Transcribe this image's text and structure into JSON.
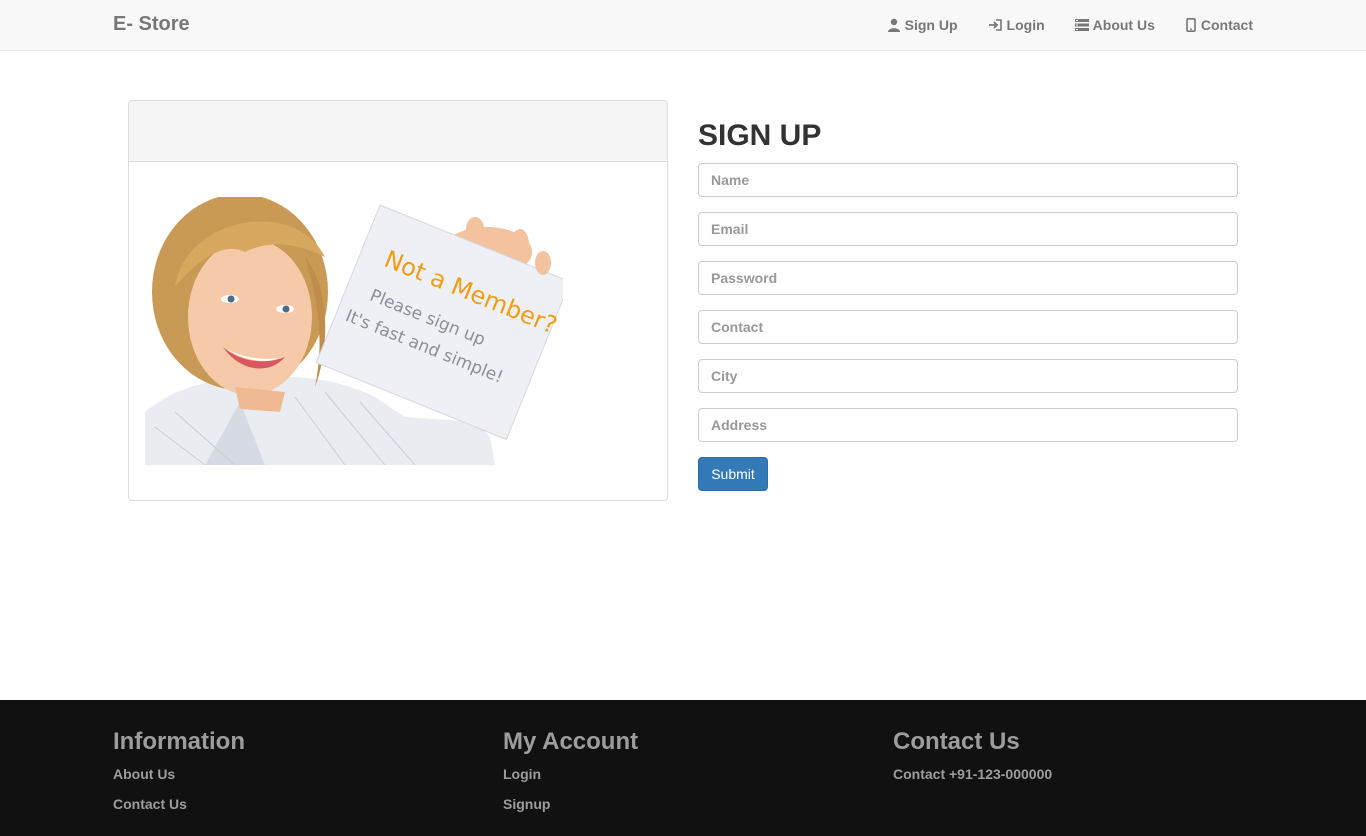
{
  "navbar": {
    "brand": "E- Store",
    "items": [
      {
        "label": "Sign Up",
        "icon": "user-icon"
      },
      {
        "label": "Login",
        "icon": "login-icon"
      },
      {
        "label": "About Us",
        "icon": "list-icon"
      },
      {
        "label": "Contact",
        "icon": "phone-icon"
      }
    ]
  },
  "promo": {
    "headline": "Not a Member?",
    "line1": "Please sign up",
    "line2": "It's fast and simple!"
  },
  "form": {
    "title": "SIGN UP",
    "name_placeholder": "Name",
    "email_placeholder": "Email",
    "password_placeholder": "Password",
    "contact_placeholder": "Contact",
    "city_placeholder": "City",
    "address_placeholder": "Address",
    "submit_label": "Submit"
  },
  "footer": {
    "information": {
      "title": "Information",
      "links": [
        "About Us",
        "Contact Us"
      ]
    },
    "account": {
      "title": "My Account",
      "links": [
        "Login",
        "Signup"
      ]
    },
    "contact": {
      "title": "Contact Us",
      "text": "Contact +91-123-000000"
    }
  },
  "colors": {
    "primary": "#337ab7",
    "footer_bg": "#111111",
    "navbar_bg": "#f8f8f8",
    "promo_accent": "#f39c12"
  }
}
